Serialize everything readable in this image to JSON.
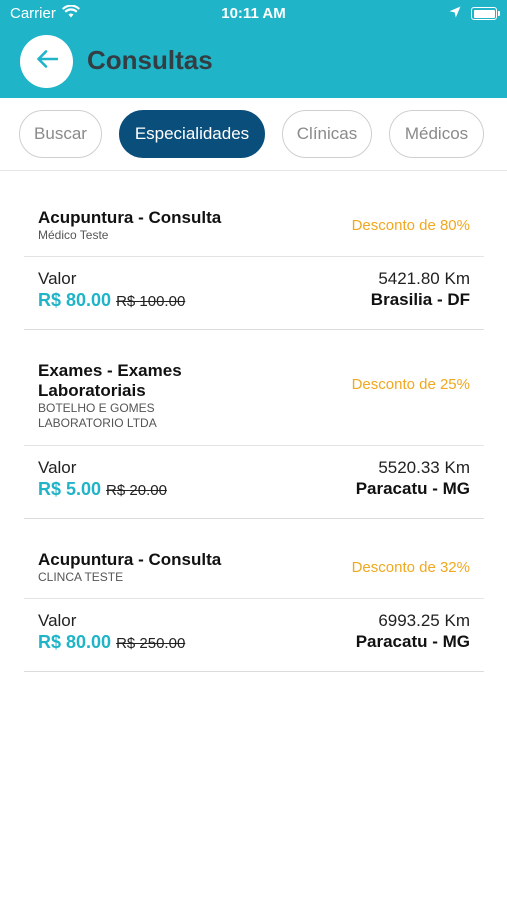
{
  "status_bar": {
    "carrier": "Carrier",
    "time": "10:11 AM"
  },
  "header": {
    "title": "Consultas",
    "background_color": "#1fb4c8"
  },
  "tabs": [
    {
      "label": "Buscar",
      "active": false
    },
    {
      "label": "Especialidades",
      "active": true
    },
    {
      "label": "Clínicas",
      "active": false
    },
    {
      "label": "Médicos",
      "active": false
    }
  ],
  "results": [
    {
      "title": "Acupuntura - Consulta",
      "subtitle": "Médico Teste",
      "discount": "Desconto de 80%",
      "valor_label": "Valor",
      "price": "R$ 80.00",
      "old_price": "R$ 100.00",
      "distance": "5421.80 Km",
      "city": "Brasilia - DF"
    },
    {
      "title_line1": "Exames - Exames",
      "title_line2": "Laboratoriais",
      "subtitle_line1": "BOTELHO E GOMES",
      "subtitle_line2": "LABORATORIO LTDA",
      "discount": "Desconto de 25%",
      "valor_label": "Valor",
      "price": "R$ 5.00",
      "old_price": "R$ 20.00",
      "distance": "5520.33 Km",
      "city": "Paracatu - MG"
    },
    {
      "title": "Acupuntura - Consulta",
      "subtitle": "CLINCA TESTE",
      "discount": "Desconto de 32%",
      "valor_label": "Valor",
      "price": "R$ 80.00",
      "old_price": "R$ 250.00",
      "distance": "6993.25 Km",
      "city": "Paracatu - MG"
    }
  ],
  "colors": {
    "accent": "#1fb4c8",
    "active_tab": "#0a4f7c",
    "discount": "#f0a81e"
  }
}
